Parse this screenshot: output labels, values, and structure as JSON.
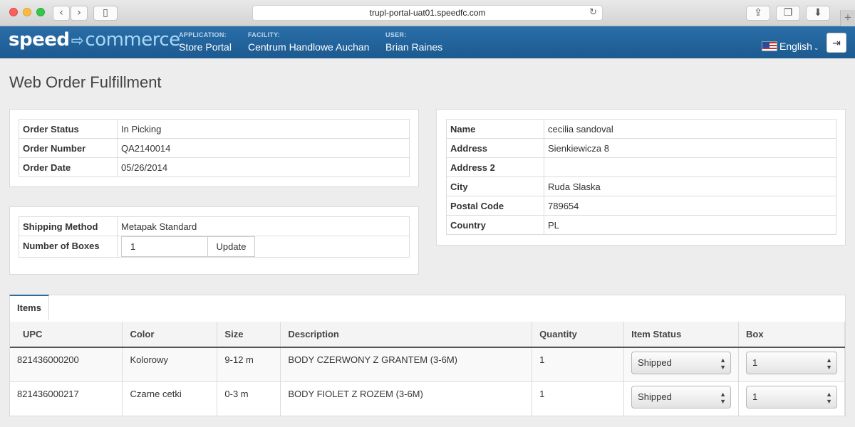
{
  "browser": {
    "url": "trupl-portal-uat01.speedfc.com"
  },
  "header": {
    "logo_left": "speed",
    "logo_right": "commerce",
    "application_label": "APPLICATION:",
    "application_value": "Store Portal",
    "facility_label": "FACILITY:",
    "facility_value": "Centrum Handlowe Auchan",
    "user_label": "USER:",
    "user_value": "Brian Raines",
    "language": "English"
  },
  "page": {
    "title": "Web Order Fulfillment"
  },
  "order": {
    "status_label": "Order Status",
    "status_value": "In Picking",
    "number_label": "Order Number",
    "number_value": "QA2140014",
    "date_label": "Order Date",
    "date_value": "05/26/2014"
  },
  "shipping": {
    "method_label": "Shipping Method",
    "method_value": "Metapak Standard",
    "boxes_label": "Number of Boxes",
    "boxes_value": "1",
    "update_label": "Update"
  },
  "customer": {
    "name_label": "Name",
    "name_value": "cecilia sandoval",
    "address_label": "Address",
    "address_value": "Sienkiewicza 8",
    "address2_label": "Address 2",
    "address2_value": "",
    "city_label": "City",
    "city_value": "Ruda Slaska",
    "postal_label": "Postal Code",
    "postal_value": "789654",
    "country_label": "Country",
    "country_value": "PL"
  },
  "items": {
    "tab_label": "Items",
    "columns": [
      "UPC",
      "Color",
      "Size",
      "Description",
      "Quantity",
      "Item Status",
      "Box"
    ],
    "rows": [
      {
        "upc": "821436000200",
        "color": "Kolorowy",
        "size": "9-12 m",
        "description": "BODY CZERWONY Z GRANTEM (3-6M)",
        "quantity": "1",
        "status": "Shipped",
        "box": "1"
      },
      {
        "upc": "821436000217",
        "color": "Czarne cetki",
        "size": "0-3 m",
        "description": "BODY FIOLET Z ROZEM (3-6M)",
        "quantity": "1",
        "status": "Shipped",
        "box": "1"
      }
    ]
  }
}
